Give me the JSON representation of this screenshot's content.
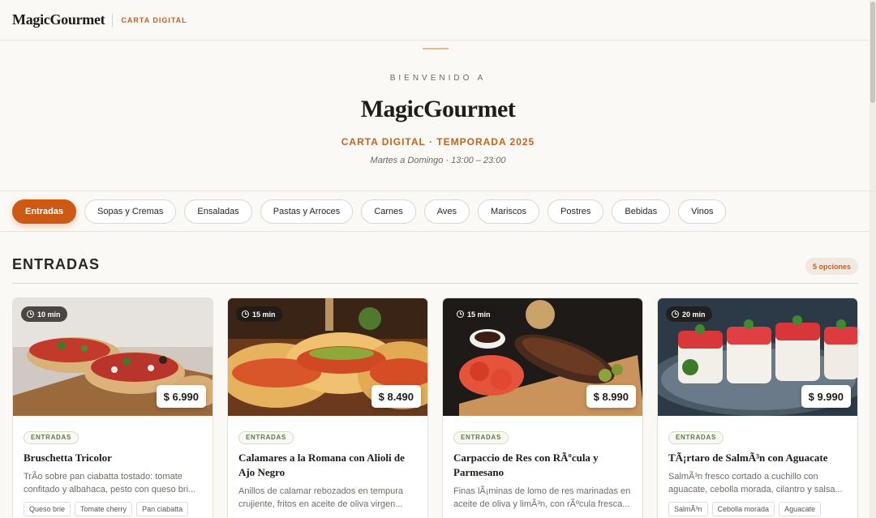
{
  "header": {
    "brand": "MagicGourmet",
    "subtitle": "CARTA DIGITAL"
  },
  "hero": {
    "welcome": "BIENVENIDO A",
    "title": "MagicGourmet",
    "subtitle": "CARTA DIGITAL · TEMPORADA 2025",
    "hours": "Martes a Domingo · 13:00 – 23:00"
  },
  "tabs": [
    {
      "label": "Entradas",
      "active": true
    },
    {
      "label": "Sopas y Cremas"
    },
    {
      "label": "Ensaladas"
    },
    {
      "label": "Pastas y Arroces"
    },
    {
      "label": "Carnes"
    },
    {
      "label": "Aves"
    },
    {
      "label": "Mariscos"
    },
    {
      "label": "Postres"
    },
    {
      "label": "Bebidas"
    },
    {
      "label": "Vinos"
    }
  ],
  "section": {
    "title": "ENTRADAS",
    "count": "5 opciones"
  },
  "colors": {
    "accent": "#cc5a15",
    "tag_green": "#5e7a45"
  },
  "cards": [
    {
      "time": "10 min",
      "price": "$ 6.990",
      "category": "ENTRADAS",
      "title": "Bruschetta Tricolor",
      "description": "TrÃo sobre pan ciabatta tostado: tomate confitado y albahaca, pesto con queso bri...",
      "chips": [
        "Queso brie",
        "Tomate cherry",
        "Pan ciabatta"
      ]
    },
    {
      "time": "15 min",
      "price": "$ 8.490",
      "category": "ENTRADAS",
      "title": "Calamares a la Romana con Alioli de Ajo Negro",
      "description": "Anillos de calamar rebozados en tempura crujiente, fritos en aceite de oliva virgen...",
      "chips": []
    },
    {
      "time": "15 min",
      "price": "$ 8.990",
      "category": "ENTRADAS",
      "title": "Carpaccio de Res con RÃºcula y Parmesano",
      "description": "Finas lÃ¡minas de lomo de res marinadas en aceite de oliva y limÃ³n, con rÃºcula fresca...",
      "chips": []
    },
    {
      "time": "20 min",
      "price": "$ 9.990",
      "category": "ENTRADAS",
      "title": "TÃ¡rtaro de SalmÃ³n con Aguacate",
      "description": "SalmÃ³n fresco cortado a cuchillo con aguacate, cebolla morada, cilantro y salsa...",
      "chips": [
        "SalmÃ³n",
        "Cebolla morada",
        "Aguacate"
      ]
    }
  ]
}
